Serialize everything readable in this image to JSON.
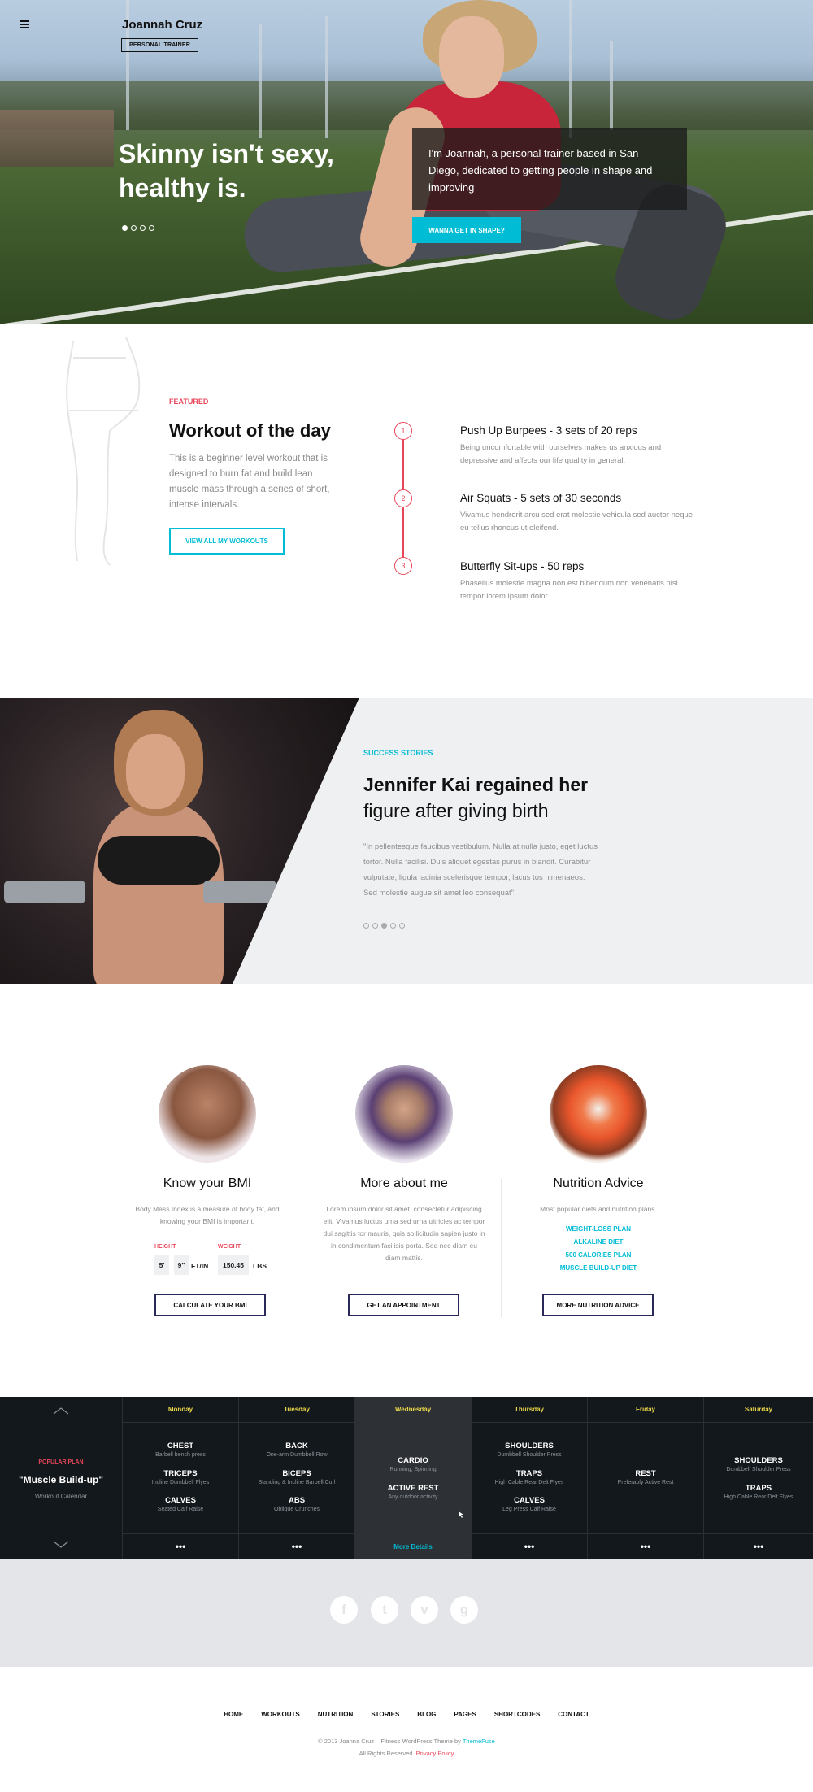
{
  "header": {
    "brand": "Joannah Cruz",
    "tagline": "PERSONAL TRAINER"
  },
  "hero": {
    "title": "Skinny isn't sexy, healthy is.",
    "intro": "I'm Joannah, a personal trainer based in San Diego, dedicated to getting people in shape and improving",
    "cta": "WANNA GET IN SHAPE?",
    "slides": 4,
    "active_slide": 1
  },
  "workout": {
    "label": "FEATURED",
    "title": "Workout of the day",
    "description": "This is a beginner level workout that is designed to burn fat and build lean muscle mass through a series of short, intense intervals.",
    "button": "VIEW ALL MY WORKOUTS",
    "steps": [
      {
        "num": "1",
        "title": "Push Up Burpees - 3 sets of 20 reps",
        "desc": "Being uncomfortable with ourselves makes us anxious and depressive and affects our life quality in general."
      },
      {
        "num": "2",
        "title": "Air Squats - 5 sets of 30 seconds",
        "desc": "Vivamus hendrerit arcu sed erat molestie vehicula sed auctor neque eu tellus rhoncus ut eleifend."
      },
      {
        "num": "3",
        "title": "Butterfly Sit-ups - 50 reps",
        "desc": "Phasellus molestie magna non est bibendum non venenatis nisl tempor lorem ipsum dolor."
      }
    ]
  },
  "story": {
    "label": "SUCCESS STORIES",
    "title_bold": "Jennifer Kai regained her",
    "title_rest": "figure after giving birth",
    "quote": "\"In pellentesque faucibus vestibulum. Nulla at nulla justo, eget luctus tortor. Nulla facilisi. Duis aliquet egestas purus in blandit. Curabitur vulputate, ligula lacinia scelerisque tempor, lacus tos himenaeos. Sed molestie augue sit amet leo consequat\".",
    "slides": 5,
    "active_slide": 3
  },
  "columns": {
    "bmi": {
      "title": "Know your BMI",
      "text": "Body Mass Index is a measure of body fat, and knowing your BMI is important.",
      "height_label": "HEIGHT",
      "weight_label": "WEIGHT",
      "feet": "5'",
      "inches": "9\"",
      "height_unit": "FT/IN",
      "weight": "150.45",
      "weight_unit": "LBS",
      "button": "CALCULATE YOUR BMI"
    },
    "about": {
      "title": "More about me",
      "text": "Lorem ipsum dolor sit amet, consectetur adipiscing elit. Vivamus luctus urna sed urna ultricies ac tempor dui sagittis tor mauris, quis sollicitudin sapien justo in in condimentum facilisis porta. Sed nec diam eu diam mattis.",
      "button": "GET AN APPOINTMENT"
    },
    "nutrition": {
      "title": "Nutrition Advice",
      "text": "Most popular diets and nutrition plans.",
      "plans": [
        "WEIGHT-LOSS PLAN",
        "ALKALINE DIET",
        "500 CALORIES PLAN",
        "MUSCLE BUILD-UP DIET"
      ],
      "button": "MORE NUTRITION ADVICE"
    }
  },
  "calendar": {
    "plan_label": "POPULAR PLAN",
    "plan_name": "\"Muscle Build-up\"",
    "plan_sub": "Workout Calendar",
    "more_details": "More Details",
    "more_dots": "•••",
    "days": [
      {
        "name": "Monday",
        "items": [
          {
            "t": "CHEST",
            "s": "Barbell bench press"
          },
          {
            "t": "TRICEPS",
            "s": "Incline Dumbbell Flyes"
          },
          {
            "t": "CALVES",
            "s": "Seated Calf Raise"
          }
        ]
      },
      {
        "name": "Tuesday",
        "items": [
          {
            "t": "BACK",
            "s": "One-arm Dumbbell Row"
          },
          {
            "t": "BICEPS",
            "s": "Standing & Incline Barbell Curl"
          },
          {
            "t": "ABS",
            "s": "Oblique Crunches"
          }
        ]
      },
      {
        "name": "Wednesday",
        "items": [
          {
            "t": "CARDIO",
            "s": "Running, Spinning"
          },
          {
            "t": "ACTIVE REST",
            "s": "Any outdoor activity"
          }
        ]
      },
      {
        "name": "Thursday",
        "items": [
          {
            "t": "SHOULDERS",
            "s": "Dumbbell Shoulder Press"
          },
          {
            "t": "TRAPS",
            "s": "High Cable Rear Delt Flyes"
          },
          {
            "t": "CALVES",
            "s": "Leg Press Calf Raise"
          }
        ]
      },
      {
        "name": "Friday",
        "items": [
          {
            "t": "REST",
            "s": "Preferably Active Rest"
          }
        ]
      },
      {
        "name": "Saturday",
        "items": [
          {
            "t": "SHOULDERS",
            "s": "Dumbbell Shoulder Press"
          },
          {
            "t": "TRAPS",
            "s": "High Cable Rear Delt Flyes"
          }
        ]
      }
    ]
  },
  "social": [
    {
      "icon": "facebook-icon",
      "glyph": "f"
    },
    {
      "icon": "twitter-icon",
      "glyph": "t"
    },
    {
      "icon": "vimeo-icon",
      "glyph": "v"
    },
    {
      "icon": "google-icon",
      "glyph": "g"
    }
  ],
  "footer": {
    "nav": [
      "HOME",
      "WORKOUTS",
      "NUTRITION",
      "STORIES",
      "BLOG",
      "PAGES",
      "SHORTCODES",
      "CONTACT"
    ],
    "copy_prefix": "© 2013 Joanna Cruz – Fitness WordPress Theme by ",
    "copy_link": "ThemeFuse",
    "rights": "All Rights Reserved. ",
    "privacy": "Privacy Policy"
  },
  "colors": {
    "accent_cyan": "#00bcd4",
    "accent_red": "#e8465a",
    "calendar_bg": "#13181c",
    "day_yellow": "#e9d64a"
  }
}
